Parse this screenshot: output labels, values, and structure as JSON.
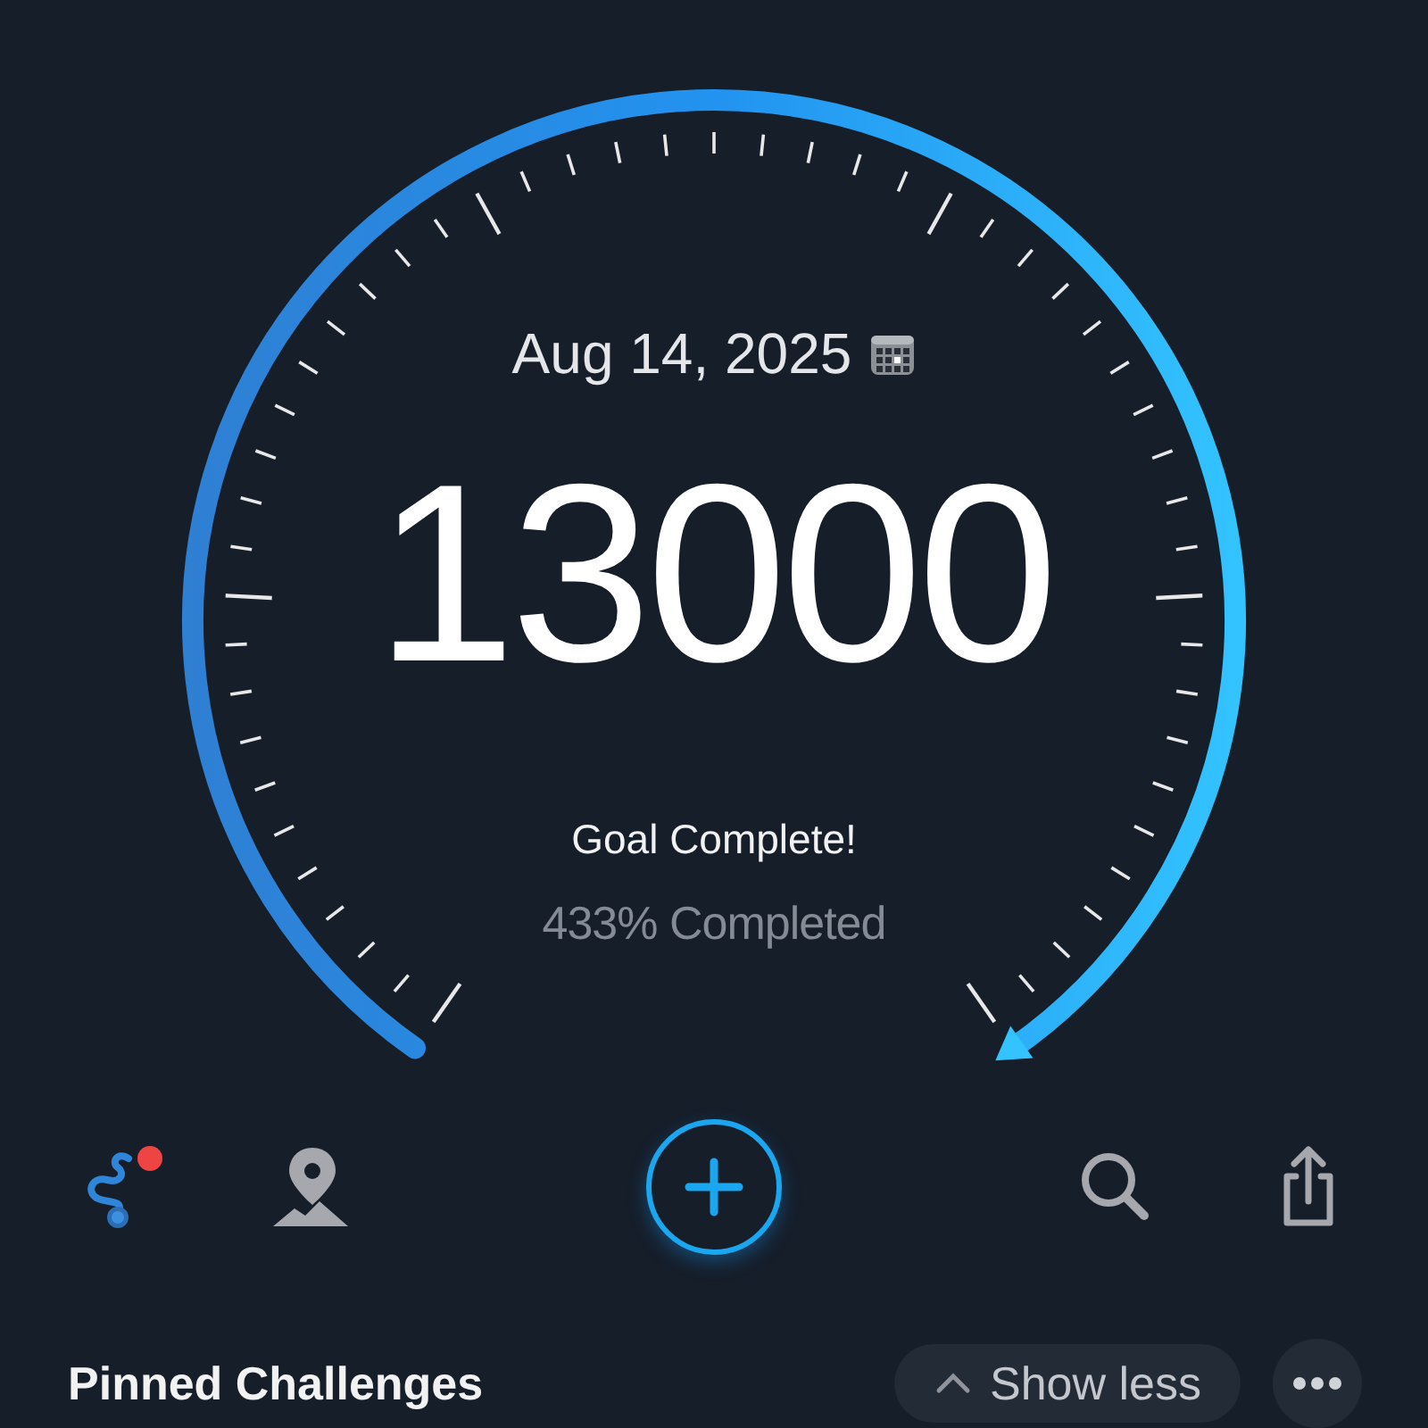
{
  "date": "Aug 14, 2025",
  "steps": "13000",
  "goal_message": "Goal Complete!",
  "percent_completed": "433% Completed",
  "pinned": {
    "title": "Pinned Challenges",
    "toggle_label": "Show less"
  }
}
